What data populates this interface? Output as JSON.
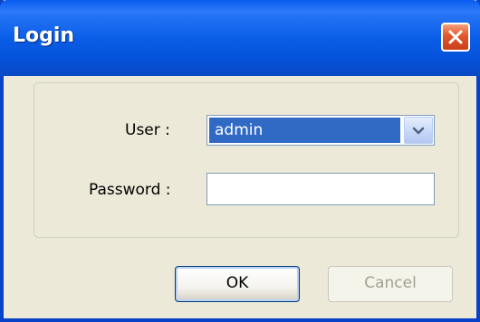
{
  "window": {
    "title": "Login"
  },
  "form": {
    "user_label": "User :",
    "user_value": "admin",
    "password_label": "Password :",
    "password_value": ""
  },
  "buttons": {
    "ok_label": "OK",
    "cancel_label": "Cancel",
    "cancel_enabled": false
  },
  "icons": {
    "close": "close-icon",
    "dropdown": "chevron-down-icon"
  },
  "colors": {
    "title_bar": "#0b5ee8",
    "close_button": "#e2562a",
    "selection": "#316ac5",
    "dialog_background": "#ece9d8"
  }
}
